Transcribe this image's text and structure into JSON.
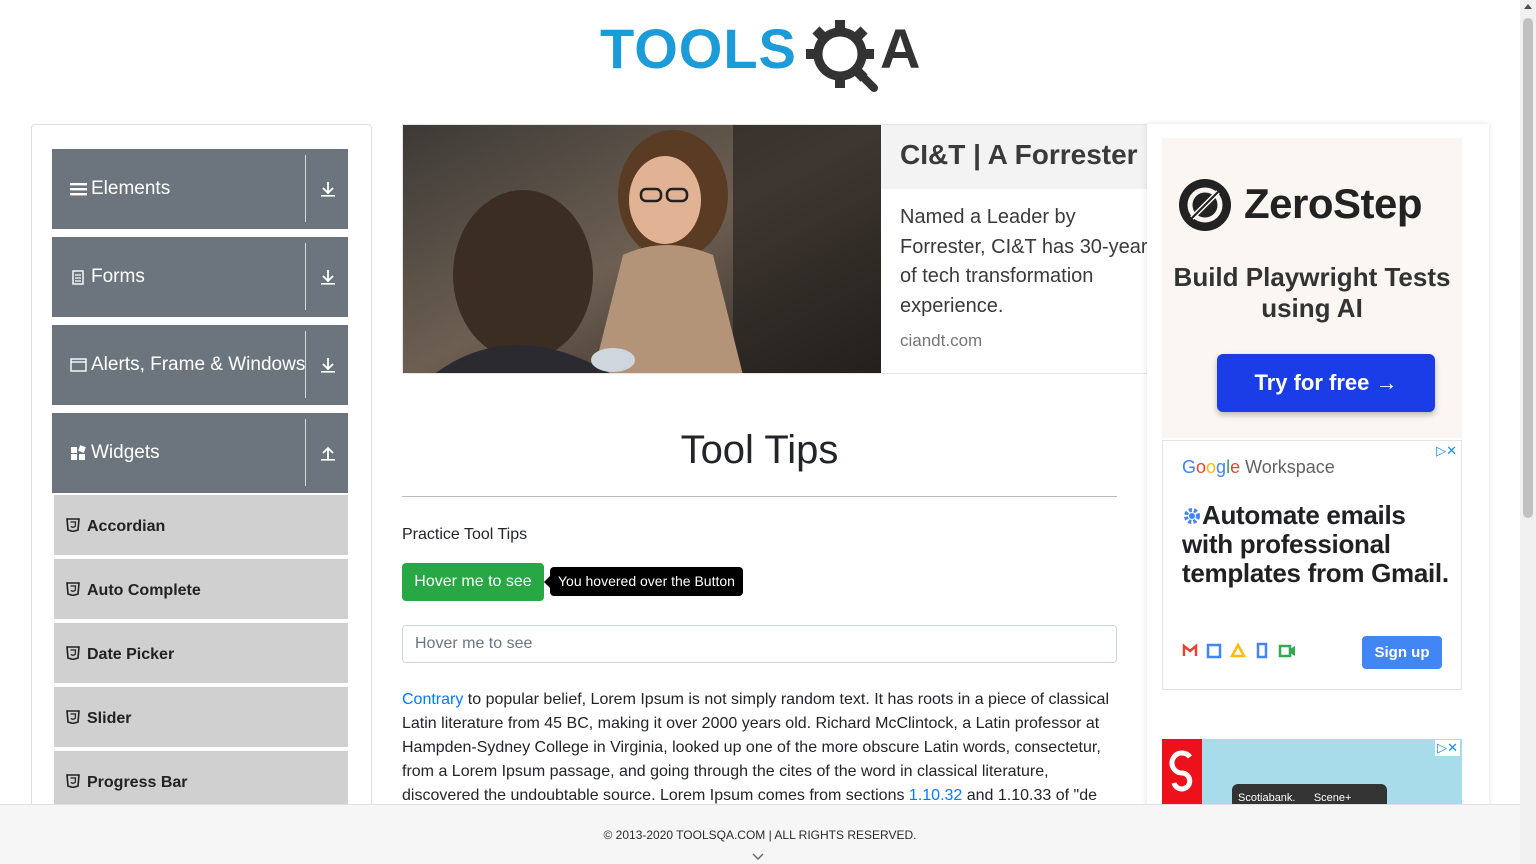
{
  "header": {
    "logo_text": "TOOLSQA",
    "logo_part1": "TOOLS",
    "logo_part2": "A",
    "logo_icon": "gear-magnifier-icon"
  },
  "sidebar": {
    "groups": [
      {
        "label": "Elements",
        "icon": "hamburger-icon",
        "arrow": "download-arrow-icon"
      },
      {
        "label": "Forms",
        "icon": "document-icon",
        "arrow": "download-arrow-icon"
      },
      {
        "label": "Alerts, Frame & Windows",
        "icon": "window-icon",
        "arrow": "download-arrow-icon"
      },
      {
        "label": "Widgets",
        "icon": "grid-icon",
        "arrow": "upload-arrow-icon"
      }
    ],
    "widget_items": [
      {
        "label": "Accordian",
        "icon": "html5-icon"
      },
      {
        "label": "Auto Complete",
        "icon": "html5-icon"
      },
      {
        "label": "Date Picker",
        "icon": "html5-icon"
      },
      {
        "label": "Slider",
        "icon": "html5-icon"
      },
      {
        "label": "Progress Bar",
        "icon": "html5-icon"
      }
    ]
  },
  "ad_banner": {
    "headline": "CI&T | A Forrester",
    "body": "Named a Leader by Forrester, CI&T has 30-year of tech transformation experience.",
    "domain": "ciandt.com"
  },
  "main": {
    "title": "Tool Tips",
    "practice_label": "Practice Tool Tips",
    "button_label": "Hover me to see",
    "tooltip_text": "You hovered over the Button",
    "input_placeholder": "Hover me to see",
    "lorem_link1": "Contrary",
    "lorem_text1": " to popular belief, Lorem Ipsum is not simply random text. It has roots in a piece of classical Latin literature from 45 BC, making it over 2000 years old. Richard McClintock, a Latin professor at Hampden-Sydney College in Virginia, looked up one of the more obscure Latin words, consectetur, from a Lorem Ipsum passage, and going through the cites of the word in classical literature, discovered the undoubtable source. Lorem Ipsum comes from sections ",
    "lorem_link2": "1.10.32",
    "lorem_text2": " and 1.10.33 of \"de"
  },
  "ads_right": {
    "zerostep": {
      "name": "ZeroStep",
      "tagline": "Build Playwright Tests using AI",
      "cta": "Try for free →"
    },
    "google": {
      "brand_g": "G",
      "brand_o1": "o",
      "brand_o2": "o",
      "brand_g2": "g",
      "brand_l": "l",
      "brand_e": "e",
      "brand_workspace": " Workspace",
      "headline": "Automate emails with professional templates from Gmail.",
      "cta": "Sign up",
      "adchoice": "▷✕"
    },
    "scotia": {
      "card_brand": "Scotiabank.",
      "card_brand2": "Scene+",
      "adchoice": "▷✕"
    }
  },
  "footer": {
    "copyright": "© 2013-2020 TOOLSQA.COM | ALL RIGHTS RESERVED."
  },
  "colors": {
    "logo_blue": "#1b9bd8",
    "logo_dark": "#333333",
    "sidebar_header": "#6c757d",
    "sidebar_item": "#d0d0d0",
    "button_green": "#28a745",
    "link_blue": "#007bff",
    "zerostep_blue": "#1b3de8",
    "google_blue": "#4285f4"
  }
}
